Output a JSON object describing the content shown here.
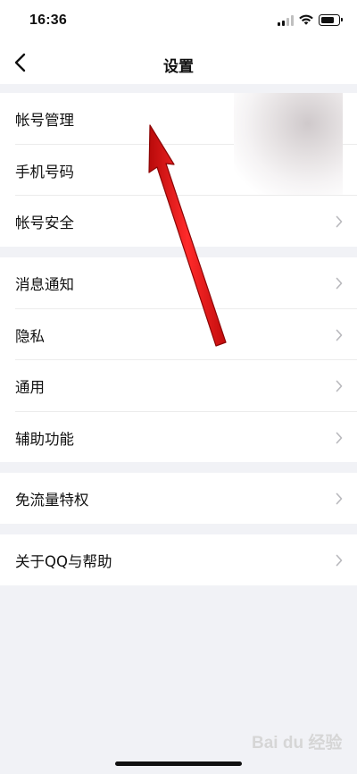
{
  "status_bar": {
    "time": "16:36"
  },
  "nav": {
    "title": "设置"
  },
  "groups": [
    {
      "items": [
        {
          "label": "帐号管理"
        },
        {
          "label": "手机号码"
        },
        {
          "label": "帐号安全"
        }
      ]
    },
    {
      "items": [
        {
          "label": "消息通知"
        },
        {
          "label": "隐私"
        },
        {
          "label": "通用"
        },
        {
          "label": "辅助功能"
        }
      ]
    },
    {
      "items": [
        {
          "label": "免流量特权"
        }
      ]
    },
    {
      "items": [
        {
          "label": "关于QQ与帮助"
        }
      ]
    }
  ],
  "icons": {
    "back": "chevron-left-icon",
    "row_chevron": "chevron-right-icon"
  },
  "annotation": {
    "arrow_color": "#e01010"
  },
  "watermark": "Bai du 经验"
}
